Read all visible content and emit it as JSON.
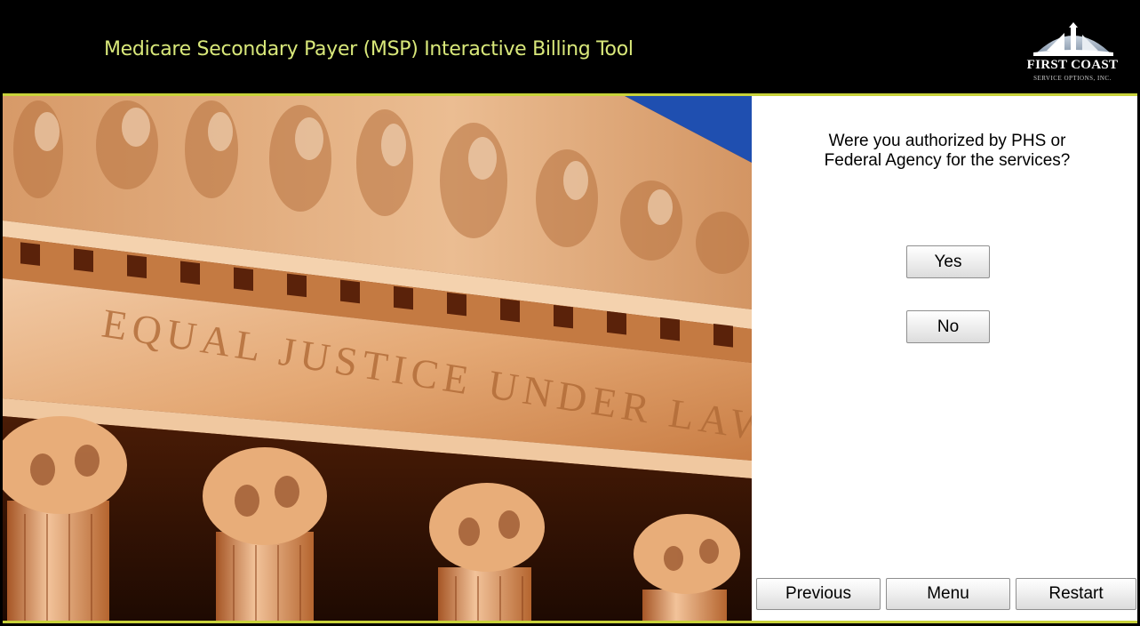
{
  "header": {
    "title": "Medicare Secondary Payer (MSP) Interactive Billing Tool",
    "logo_name": "FIRST COAST",
    "logo_sub": "SERVICE OPTIONS, INC."
  },
  "photo": {
    "inscription": "EQUAL JUSTICE UNDER LAW"
  },
  "question": {
    "line1": "Were you authorized by PHS or",
    "line2": "Federal Agency for the services?"
  },
  "answers": {
    "yes_label": "Yes",
    "no_label": "No"
  },
  "nav": {
    "previous_label": "Previous",
    "menu_label": "Menu",
    "restart_label": "Restart"
  },
  "colors": {
    "header_bg": "#000000",
    "title_text": "#d9e87a",
    "accent_line": "#c8d23a"
  }
}
